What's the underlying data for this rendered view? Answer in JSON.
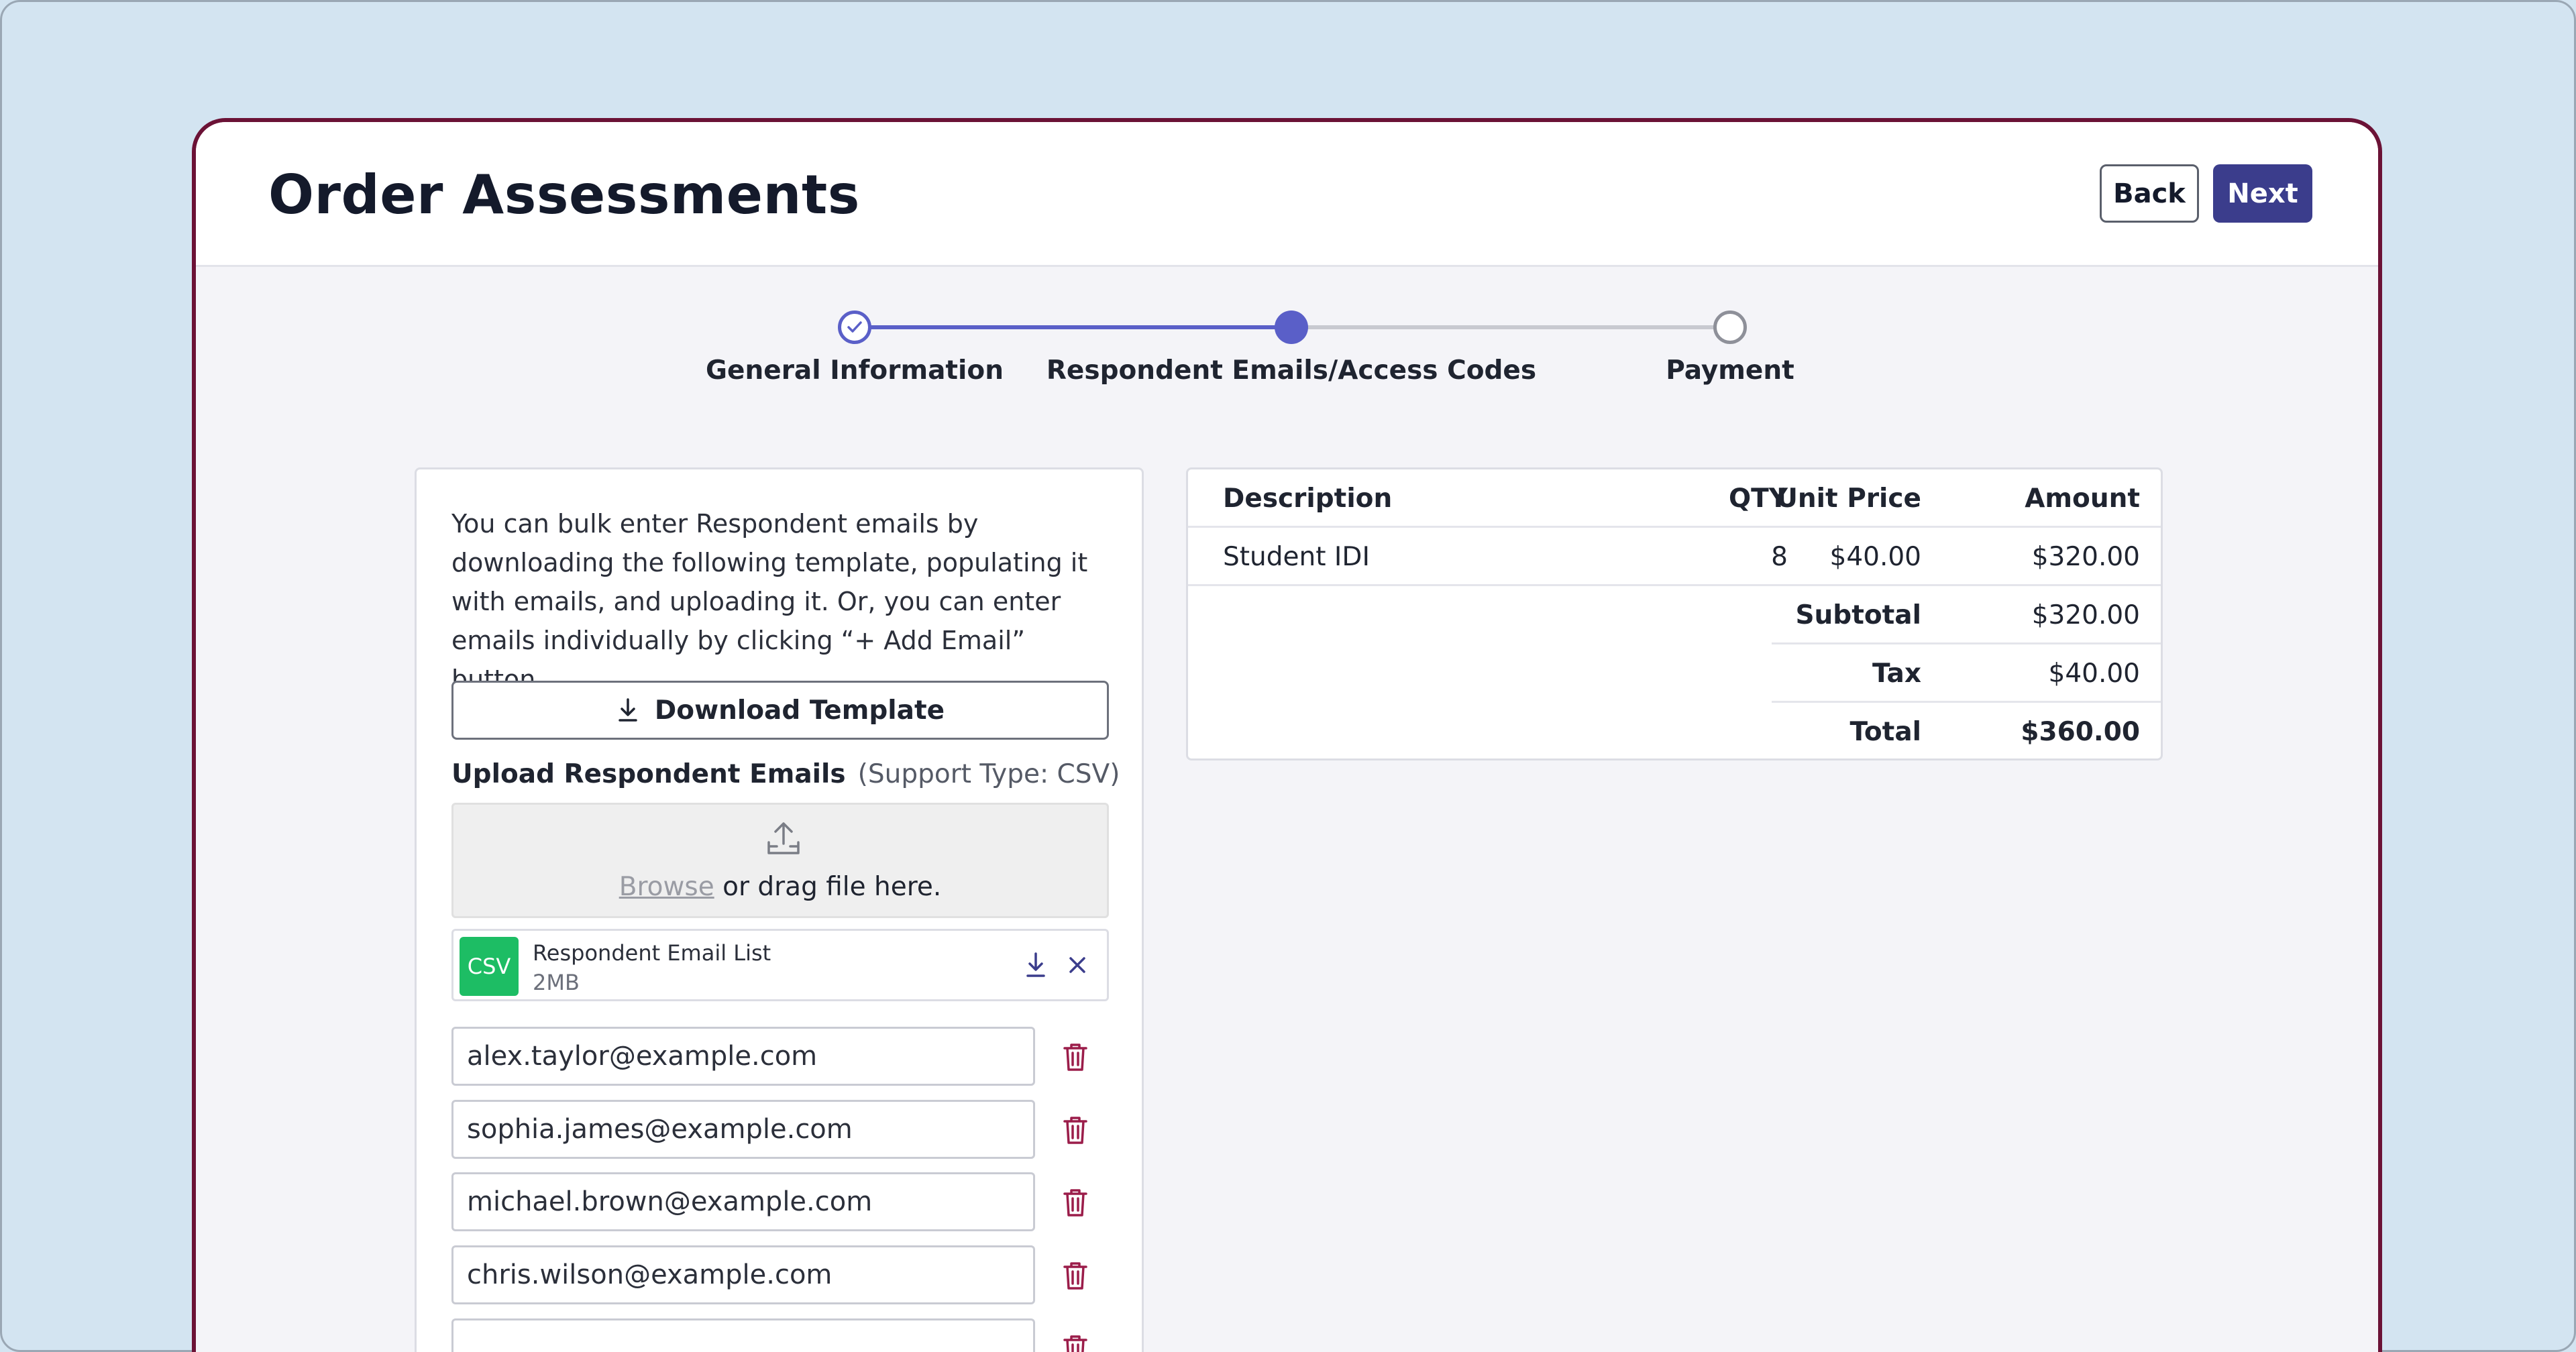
{
  "header": {
    "title": "Order Assessments",
    "back_label": "Back",
    "next_label": "Next"
  },
  "stepper": {
    "steps": [
      {
        "label": "General Information",
        "state": "complete"
      },
      {
        "label": "Respondent Emails/Access Codes",
        "state": "current"
      },
      {
        "label": "Payment",
        "state": "upcoming"
      }
    ],
    "accent_color": "#5a5fc8"
  },
  "upload": {
    "instructions": "You can bulk enter Respondent emails by downloading the following template, populating it with emails, and uploading it. Or, you can enter emails individually by clicking “+ Add Email” button.",
    "download_label": "Download Template",
    "section_title": "Upload Respondent Emails",
    "support_type": "(Support Type: CSV)",
    "browse_label": "Browse",
    "drop_text": " or drag file here.",
    "file": {
      "badge": "CSV",
      "name": "Respondent Email List",
      "size": "2MB"
    }
  },
  "emails": [
    "alex.taylor@example.com",
    "sophia.james@example.com",
    "michael.brown@example.com",
    "chris.wilson@example.com"
  ],
  "order_table": {
    "headers": {
      "description": "Description",
      "qty": "QTY",
      "unit_price": "Unit Price",
      "amount": "Amount"
    },
    "items": [
      {
        "description": "Student IDI",
        "qty": "8",
        "unit_price": "$40.00",
        "amount": "$320.00"
      }
    ],
    "subtotal_label": "Subtotal",
    "subtotal": "$320.00",
    "tax_label": "Tax",
    "tax": "$40.00",
    "total_label": "Total",
    "total": "$360.00"
  }
}
